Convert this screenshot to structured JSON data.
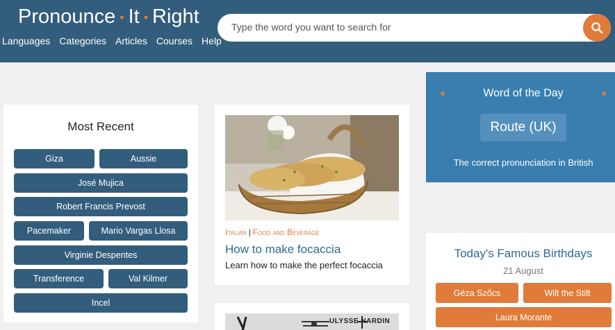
{
  "header": {
    "logo": {
      "part1": "Pronounce",
      "part2": "It",
      "part3": "Right",
      "separator": "•"
    },
    "nav": [
      "Languages",
      "Categories",
      "Articles",
      "Courses",
      "Help"
    ],
    "search": {
      "placeholder": "Type the word you want to search for",
      "icon": "search-icon"
    }
  },
  "most_recent": {
    "title": "Most Recent",
    "chips": [
      "Giza",
      "Aussie",
      "José Mujica",
      "Robert Francis Prevost",
      "Pacemaker",
      "Mario Vargas Llosa",
      "Virginie Despentes",
      "Transference",
      "Val Kilmer",
      "Incel"
    ]
  },
  "article": {
    "category1": "Italian",
    "separator": "|",
    "category2": "Food and Beverage",
    "title": "How to make focaccia",
    "description": "Learn how to make the perfect focaccia"
  },
  "article2": {
    "image_text": "ULYSSE NARDIN"
  },
  "word_of_day": {
    "title": "Word of the Day",
    "word": "Route (UK)",
    "subtitle": "The correct pronunciation in British"
  },
  "birthdays": {
    "title": "Today's Famous Birthdays",
    "date": "21 August",
    "chips": [
      "Géza Szőcs",
      "Wilt the Stilt",
      "Laura Morante"
    ]
  },
  "colors": {
    "header": "#335d7d",
    "accent": "#e07b39",
    "chip": "#335d7d",
    "wotd": "#3a7eaf",
    "link": "#2f6a93"
  }
}
